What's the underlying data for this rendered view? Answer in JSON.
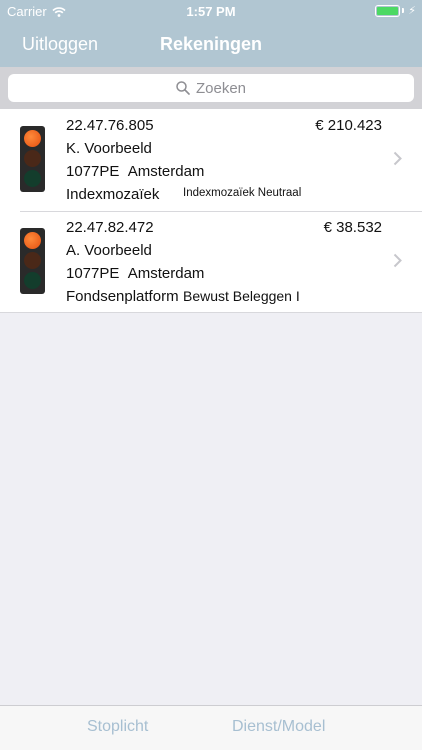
{
  "status_bar": {
    "carrier": "Carrier",
    "time": "1:57 PM",
    "battery_level": 1.0
  },
  "nav": {
    "left_button": "Uitloggen",
    "title": "Rekeningen"
  },
  "search": {
    "placeholder": "Zoeken"
  },
  "accounts": [
    {
      "number": "22.47.76.805",
      "name": "K. Voorbeeld",
      "postcode": "1077PE",
      "city": "Amsterdam",
      "service": "Indexmozaïek",
      "model": "Indexmozaïek Neutraal",
      "amount": "€ 210.423",
      "signal": "red"
    },
    {
      "number": "22.47.82.472",
      "name": "A. Voorbeeld",
      "postcode": "1077PE",
      "city": "Amsterdam",
      "service": "Fondsenplatform",
      "model": "Bewust Beleggen I",
      "amount": "€ 38.532",
      "signal": "red"
    }
  ],
  "tabs": {
    "stoplicht": "Stoplicht",
    "dienst_model": "Dienst/Model"
  },
  "colors": {
    "header": "#b1c6d2",
    "tab_text": "#a7bfd1",
    "battery": "#4cd964",
    "signal_red": "#e44f10"
  }
}
